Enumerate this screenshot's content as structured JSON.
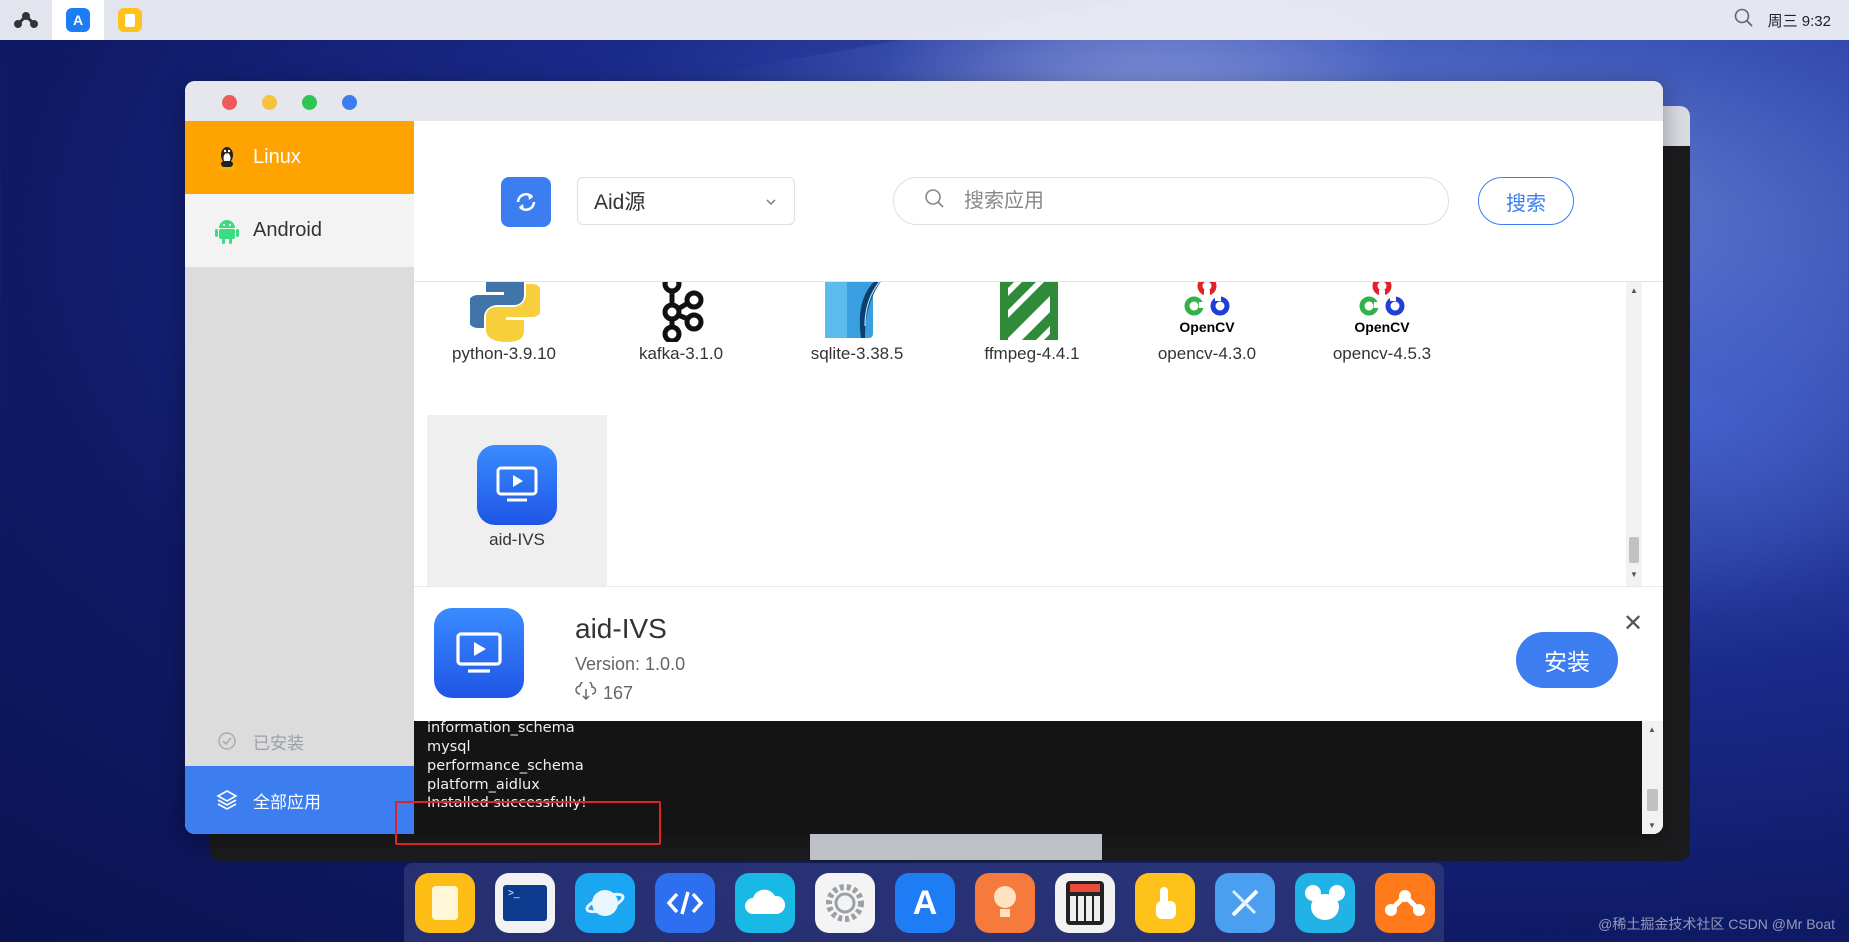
{
  "topbar": {
    "clock": "周三 9:32",
    "apps": [
      "aidlux-logo-icon",
      "app-store-icon",
      "files-icon"
    ]
  },
  "sidebar": {
    "linux_label": "Linux",
    "android_label": "Android",
    "installed_label": "已安装",
    "all_apps_label": "全部应用"
  },
  "toolbar": {
    "source_value": "Aid源",
    "search_placeholder": "搜索应用",
    "search_button": "搜索"
  },
  "apps": [
    {
      "name": "python-3.9.10",
      "icon": "python-icon"
    },
    {
      "name": "kafka-3.1.0",
      "icon": "kafka-icon"
    },
    {
      "name": "sqlite-3.38.5",
      "icon": "sqlite-icon"
    },
    {
      "name": "ffmpeg-4.4.1",
      "icon": "ffmpeg-icon"
    },
    {
      "name": "opencv-4.3.0",
      "icon": "opencv-icon",
      "icon_text": "OpenCV"
    },
    {
      "name": "opencv-4.5.3",
      "icon": "opencv-icon",
      "icon_text": "OpenCV"
    },
    {
      "name": "aid-IVS",
      "icon": "monitor-play-icon"
    }
  ],
  "detail": {
    "name": "aid-IVS",
    "version": "Version: 1.0.0",
    "downloads": "167",
    "install_button": "安装"
  },
  "terminal": {
    "lines": [
      "information_schema",
      "mysql",
      "performance_schema",
      "platform_aidlux",
      "Installed successfully!"
    ]
  },
  "watermark": "@稀土掘金技术社区  CSDN @Mr Boat",
  "colors": {
    "accent": "#3c7ef0",
    "linux_tab": "#ffa300",
    "highlight_box": "#e02222"
  }
}
